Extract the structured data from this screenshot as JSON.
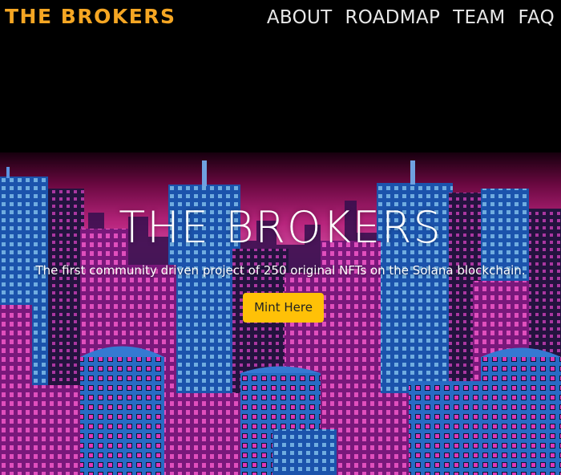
{
  "header": {
    "logo": "THE BROKERS",
    "nav": [
      {
        "label": "ABOUT"
      },
      {
        "label": "ROADMAP"
      },
      {
        "label": "TEAM"
      },
      {
        "label": "FAQ"
      }
    ]
  },
  "hero": {
    "title": "THE BROKERS",
    "subtitle": "The first community driven project of 250 original NFTs on the Solana blockchain.",
    "button_label": "Mint Here"
  },
  "colors": {
    "logo": "#f5a623",
    "button": "#ffc107",
    "sky_magenta": "#d12a8e",
    "building_blue": "#2a6fd6"
  },
  "images": {
    "hero_background": "pixel-art-city-skyline"
  }
}
